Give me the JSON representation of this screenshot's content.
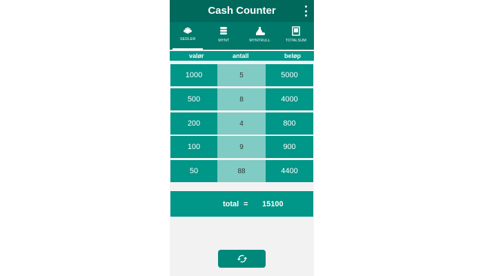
{
  "app": {
    "title": "Cash Counter"
  },
  "tabs": [
    {
      "label": "SEDLER",
      "icon": "banknotes-icon",
      "active": true
    },
    {
      "label": "MYNT",
      "icon": "coins-icon",
      "active": false
    },
    {
      "label": "MYNTRULL",
      "icon": "coin-roll-icon",
      "active": false
    },
    {
      "label": "TOTALSUM",
      "icon": "total-icon",
      "active": false
    }
  ],
  "columns": {
    "denomination": "valør",
    "count": "antall",
    "amount": "beløp"
  },
  "rows": [
    {
      "denomination": "1000",
      "count": "5",
      "amount": "5000"
    },
    {
      "denomination": "500",
      "count": "8",
      "amount": "4000"
    },
    {
      "denomination": "200",
      "count": "4",
      "amount": "800"
    },
    {
      "denomination": "100",
      "count": "9",
      "amount": "900"
    },
    {
      "denomination": "50",
      "count": "88",
      "amount": "4400"
    }
  ],
  "total": {
    "label": "total",
    "equals": "=",
    "value": "15100"
  },
  "colors": {
    "appbar": "#00695c",
    "tabs": "#00796b",
    "primary": "#009688",
    "light": "#80cbc4",
    "background": "#f2f2f2"
  }
}
